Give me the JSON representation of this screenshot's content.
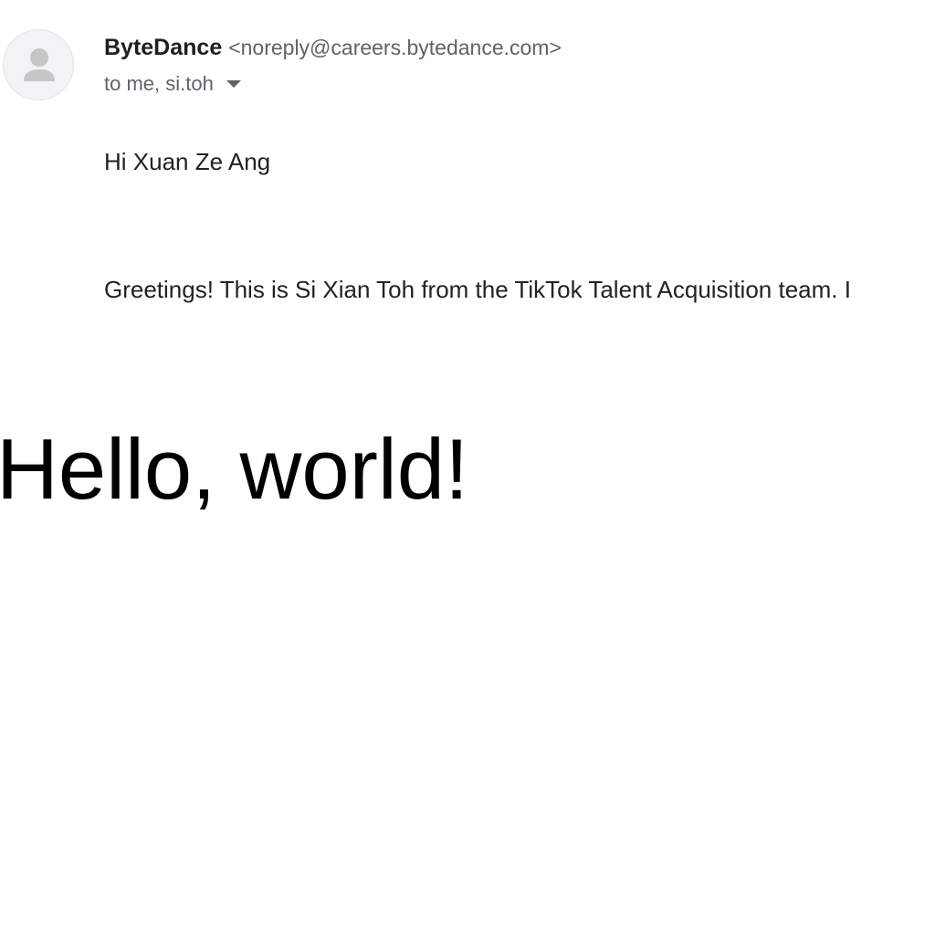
{
  "sender": {
    "name": "ByteDance",
    "email": "<noreply@careers.bytedance.com>",
    "avatar_icon": "person-icon"
  },
  "recipients": {
    "text": "to me, si.toh",
    "expand_icon": "caret-down-icon"
  },
  "message": {
    "greeting": "Hi Xuan Ze Ang",
    "body": "Greetings! This is Si Xian Toh from the TikTok Talent Acquisition team. I"
  },
  "overlay": {
    "text": "Hello, world!"
  },
  "colors": {
    "secondary_text": "#5f6368",
    "avatar_bg": "#f1f3f4",
    "avatar_fg": "#c4c4c4"
  }
}
